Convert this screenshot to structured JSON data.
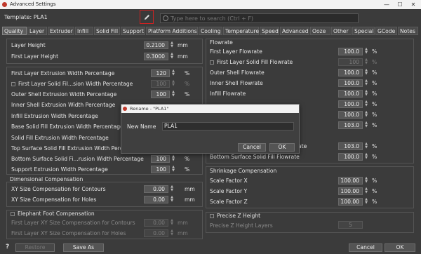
{
  "window": {
    "title": "Advanced Settings",
    "min_glyph": "—",
    "max_glyph": "☐",
    "close_glyph": "✕"
  },
  "template_label": "Template: PLA1",
  "search": {
    "placeholder": "Type here to search (Ctrl + F)"
  },
  "tabs": [
    "Quality",
    "Layer",
    "Extruder",
    "Infill",
    "Solid Fill",
    "Support",
    "Platform Additions",
    "Cooling",
    "Temperature",
    "Speed",
    "Advanced",
    "Ooze",
    "Other",
    "Special",
    "GCode",
    "Notes"
  ],
  "left": {
    "layer_height": {
      "label": "Layer Height",
      "value": "0.2100",
      "unit": "mm"
    },
    "first_layer_height": {
      "label": "First Layer Height",
      "value": "0.3000",
      "unit": "mm"
    },
    "extrusion_rows": [
      {
        "label": "First Layer Extrusion Width Percentage",
        "value": "120",
        "unit": "%"
      },
      {
        "label": "First Layer Solid Fil...sion Width Percentage",
        "value": "100",
        "unit": "%"
      },
      {
        "label": "Outer Shell Extrusion Width Percentage",
        "value": "100",
        "unit": "%"
      },
      {
        "label": "Inner Shell Extrusion Width Percentage",
        "value": "",
        "unit": ""
      },
      {
        "label": "Infill Extrusion Width Percentage",
        "value": "",
        "unit": ""
      },
      {
        "label": "Base Solid Fill Extrusion Width Percentage",
        "value": "",
        "unit": ""
      },
      {
        "label": "Solid Fill Extrusion Width Percentage",
        "value": "",
        "unit": ""
      },
      {
        "label": "Top Surface Solid Fill Extrusion Width Perc",
        "value": "",
        "unit": ""
      },
      {
        "label": "Bottom Surface Solid Fi...rusion Width Percentage",
        "value": "100",
        "unit": "%"
      },
      {
        "label": "Support Extrusion Width Percentage",
        "value": "100",
        "unit": "%"
      }
    ],
    "dimensional": {
      "title": "Dimensional Compensation",
      "rows": [
        {
          "label": "XY Size Compensation for Contours",
          "value": "0.00",
          "unit": "mm"
        },
        {
          "label": "XY Size Compensation for Holes",
          "value": "0.00",
          "unit": "mm"
        }
      ]
    },
    "elephant": {
      "title": "Elephant Foot Compensation",
      "rows": [
        {
          "label": "First Layer XY Size Compensation for Contours",
          "value": "0.00",
          "unit": "mm"
        },
        {
          "label": "First Layer XY Size Compensation for Holes",
          "value": "0.00",
          "unit": "mm"
        }
      ]
    }
  },
  "right": {
    "flowrate": {
      "title": "Flowrate",
      "rows": [
        {
          "label": "First Layer Flowrate",
          "value": "100.0",
          "unit": "%"
        },
        {
          "label": "First Layer Solid Fill Flowrate",
          "value": "100",
          "unit": "%"
        },
        {
          "label": "Outer Shell Flowrate",
          "value": "100.0",
          "unit": "%"
        },
        {
          "label": "Inner Shell Flowrate",
          "value": "100.0",
          "unit": "%"
        },
        {
          "label": "Infill Flowrate",
          "value": "100.0",
          "unit": "%"
        },
        {
          "label": "",
          "value": "100.0",
          "unit": "%"
        },
        {
          "label": "",
          "value": "100.0",
          "unit": "%"
        },
        {
          "label": "",
          "value": "103.0",
          "unit": "%"
        },
        {
          "label": "ate",
          "value": "103.0",
          "unit": "%"
        },
        {
          "label": "Bottom Surface Solid Fill Flowrate",
          "value": "100.0",
          "unit": "%"
        }
      ]
    },
    "shrinkage": {
      "title": "Shrinkage Compensation",
      "rows": [
        {
          "label": "Scale Factor X",
          "value": "100.00",
          "unit": "%"
        },
        {
          "label": "Scale Factor Y",
          "value": "100.00",
          "unit": "%"
        },
        {
          "label": "Scale Factor Z",
          "value": "100.00",
          "unit": "%"
        }
      ]
    },
    "precise_z": {
      "title": "Precise Z Height",
      "label": "Precise Z Height Layers",
      "value": "5"
    }
  },
  "footer": {
    "help": "?",
    "restore": "Restore",
    "save_as": "Save As",
    "cancel": "Cancel",
    "ok": "OK"
  },
  "dialog": {
    "title": "Rename - \"PLA1\"",
    "name_label": "New Name",
    "name_value": "PLA1",
    "cancel": "Cancel",
    "ok": "OK"
  }
}
